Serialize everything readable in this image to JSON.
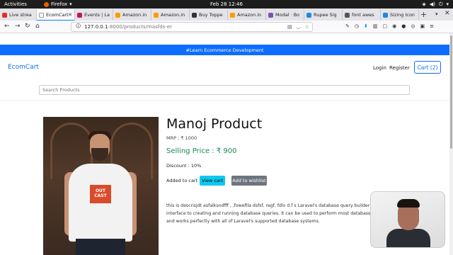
{
  "system_bar": {
    "activities": "Activities",
    "app": "Firefox",
    "clock": "Feb 28  12:46"
  },
  "tabs": [
    {
      "label": "Live strea",
      "color": "#e52d27"
    },
    {
      "label": "EcomCart",
      "color": "#0d6efd",
      "active": true
    },
    {
      "label": "Events | La",
      "color": "#c2185b"
    },
    {
      "label": "Amazon.in",
      "color": "#f90"
    },
    {
      "label": "Amazon.in",
      "color": "#f90"
    },
    {
      "label": "Buy Toppe",
      "color": "#333"
    },
    {
      "label": "Amazon.in",
      "color": "#f90"
    },
    {
      "label": "Modal · Bo",
      "color": "#7952b3"
    },
    {
      "label": "Rupee Sig",
      "color": "#1e88e5"
    },
    {
      "label": "font awes",
      "color": "#555"
    },
    {
      "label": "Sizing Icon",
      "color": "#1e88e5"
    }
  ],
  "browser": {
    "url_host": "127.0.0.1",
    "url_rest": ":8000/products/masfds-er"
  },
  "site": {
    "announcement": "#Learn Ecommerce Development",
    "brand": "EcomCart",
    "login": "Login",
    "register": "Register",
    "cart_label": "Cart (2)",
    "search_placeholder": "Search Products"
  },
  "product": {
    "image_print_line1": "OUT",
    "image_print_line2": "CAST",
    "title": "Manoj Product",
    "mrp": "MRP : ₹ 1000",
    "selling_price": "Selling Price : ₹ 900",
    "discount": "Discount : 10%",
    "added_to_cart": "Added to cart",
    "view_cart_label": "View cart",
    "wishlist_label": "Add to wishlist",
    "description_lines": [
      "this is descrisjdt asfalksndfff , ,fowefila dsfsf, regf, fdlv d.f s Laravel's database query builder provides a co",
      "interface to creating and running database queries. It can be used to perform most database operations i",
      "and works perfectly with all of Laravel's supported database systems."
    ]
  }
}
